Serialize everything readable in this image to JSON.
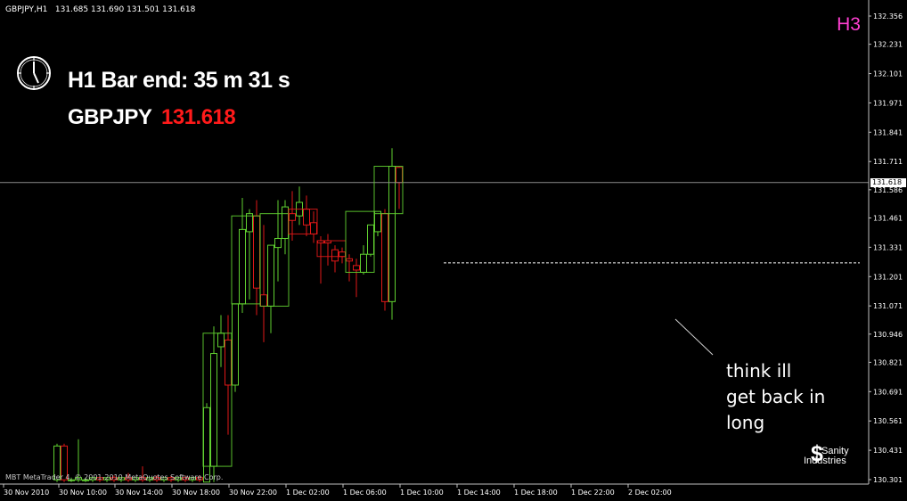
{
  "header": {
    "symbol_timeframe": "GBPJPY,H1",
    "ohlc": "131.685 131.690 131.501 131.618"
  },
  "h3_label": "H3",
  "timer": {
    "bar_end": "H1 Bar end: 35 m 31 s",
    "symbol": "GBPJPY",
    "price": "131.618",
    "icon": "clock-icon"
  },
  "annotation": {
    "lines": [
      "think ill",
      "get back in",
      "long"
    ]
  },
  "copyright": "MBT MetaTrader 4, © 2001-2010 MetaQuotes Software Corp.",
  "logo": {
    "line1": "Sanity",
    "line2": "Industries",
    "icon": "dollar-icon"
  },
  "current_price_tag": "131.618",
  "colors": {
    "background": "#000000",
    "bull": "#60d030",
    "bear": "#e01818",
    "axis": "#c0c0c0",
    "h3": "#ff3fd2",
    "timer_price": "#ff1a1a"
  },
  "chart_data": {
    "type": "candlestick",
    "symbol": "GBPJPY",
    "timeframe": "H1",
    "y_ticks": [
      "132.356",
      "132.231",
      "132.101",
      "131.971",
      "131.841",
      "131.711",
      "131.586",
      "131.461",
      "131.331",
      "131.201",
      "131.071",
      "130.946",
      "130.821",
      "130.691",
      "130.561",
      "130.431",
      "130.301"
    ],
    "x_ticks": [
      "30 Nov 2010",
      "30 Nov 10:00",
      "30 Nov 14:00",
      "30 Nov 18:00",
      "30 Nov 22:00",
      "1 Dec 02:00",
      "1 Dec 06:00",
      "1 Dec 10:00",
      "1 Dec 14:00",
      "1 Dec 18:00",
      "1 Dec 22:00",
      "2 Dec 02:00"
    ],
    "ylim": [
      130.29,
      132.4
    ],
    "current_price": 131.618,
    "h3_level": 131.262,
    "candles": [
      {
        "o": 130.3,
        "h": 130.46,
        "l": 130.29,
        "c": 130.45
      },
      {
        "o": 130.45,
        "h": 130.46,
        "l": 130.29,
        "c": 130.3
      },
      {
        "o": 130.3,
        "h": 130.31,
        "l": 130.29,
        "c": 130.3
      },
      {
        "o": 130.3,
        "h": 130.48,
        "l": 130.29,
        "c": 130.31
      },
      {
        "o": 130.3,
        "h": 130.31,
        "l": 130.29,
        "c": 130.3
      },
      {
        "o": 130.3,
        "h": 130.31,
        "l": 130.29,
        "c": 130.31
      },
      {
        "o": 130.31,
        "h": 130.32,
        "l": 130.29,
        "c": 130.3
      },
      {
        "o": 130.3,
        "h": 130.31,
        "l": 130.29,
        "c": 130.31
      },
      {
        "o": 130.31,
        "h": 130.32,
        "l": 130.29,
        "c": 130.3
      },
      {
        "o": 130.3,
        "h": 130.31,
        "l": 130.29,
        "c": 130.31
      },
      {
        "o": 130.31,
        "h": 130.33,
        "l": 130.29,
        "c": 130.3
      },
      {
        "o": 130.3,
        "h": 130.31,
        "l": 130.29,
        "c": 130.31
      },
      {
        "o": 130.31,
        "h": 130.36,
        "l": 130.29,
        "c": 130.3
      },
      {
        "o": 130.3,
        "h": 130.31,
        "l": 130.29,
        "c": 130.31
      },
      {
        "o": 130.31,
        "h": 130.32,
        "l": 130.29,
        "c": 130.3
      },
      {
        "o": 130.3,
        "h": 130.31,
        "l": 130.29,
        "c": 130.31
      },
      {
        "o": 130.31,
        "h": 130.32,
        "l": 130.29,
        "c": 130.3
      },
      {
        "o": 130.3,
        "h": 130.31,
        "l": 130.29,
        "c": 130.31
      },
      {
        "o": 130.31,
        "h": 130.32,
        "l": 130.29,
        "c": 130.3
      },
      {
        "o": 130.3,
        "h": 130.31,
        "l": 130.29,
        "c": 130.31
      },
      {
        "o": 130.31,
        "h": 130.32,
        "l": 130.29,
        "c": 130.3
      },
      {
        "o": 130.29,
        "h": 130.64,
        "l": 130.29,
        "c": 130.62
      },
      {
        "o": 130.36,
        "h": 130.98,
        "l": 130.29,
        "c": 130.86
      },
      {
        "o": 130.89,
        "h": 131.03,
        "l": 130.8,
        "c": 130.95
      },
      {
        "o": 130.92,
        "h": 131.03,
        "l": 130.5,
        "c": 130.72
      },
      {
        "o": 130.72,
        "h": 131.08,
        "l": 130.69,
        "c": 131.08
      },
      {
        "o": 131.08,
        "h": 131.55,
        "l": 131.04,
        "c": 131.41
      },
      {
        "o": 131.4,
        "h": 131.5,
        "l": 131.1,
        "c": 131.48
      },
      {
        "o": 131.47,
        "h": 131.54,
        "l": 131.03,
        "c": 131.15
      },
      {
        "o": 131.12,
        "h": 131.43,
        "l": 130.91,
        "c": 131.07
      },
      {
        "o": 131.07,
        "h": 131.3,
        "l": 130.95,
        "c": 131.34
      },
      {
        "o": 131.33,
        "h": 131.54,
        "l": 131.18,
        "c": 131.37
      },
      {
        "o": 131.37,
        "h": 131.54,
        "l": 131.3,
        "c": 131.51
      },
      {
        "o": 131.48,
        "h": 131.58,
        "l": 131.36,
        "c": 131.45
      },
      {
        "o": 131.47,
        "h": 131.6,
        "l": 131.43,
        "c": 131.53
      },
      {
        "o": 131.5,
        "h": 131.56,
        "l": 131.38,
        "c": 131.43
      },
      {
        "o": 131.44,
        "h": 131.49,
        "l": 131.35,
        "c": 131.39
      },
      {
        "o": 131.36,
        "h": 131.38,
        "l": 131.17,
        "c": 131.35
      },
      {
        "o": 131.36,
        "h": 131.39,
        "l": 131.25,
        "c": 131.35
      },
      {
        "o": 131.32,
        "h": 131.34,
        "l": 131.22,
        "c": 131.27
      },
      {
        "o": 131.31,
        "h": 131.33,
        "l": 131.26,
        "c": 131.29
      },
      {
        "o": 131.28,
        "h": 131.3,
        "l": 131.18,
        "c": 131.27
      },
      {
        "o": 131.25,
        "h": 131.28,
        "l": 131.11,
        "c": 131.23
      },
      {
        "o": 131.22,
        "h": 131.34,
        "l": 131.21,
        "c": 131.3
      },
      {
        "o": 131.3,
        "h": 131.42,
        "l": 131.29,
        "c": 131.43
      },
      {
        "o": 131.4,
        "h": 131.49,
        "l": 131.38,
        "c": 131.49
      },
      {
        "o": 131.48,
        "h": 131.5,
        "l": 131.05,
        "c": 131.09
      },
      {
        "o": 131.09,
        "h": 131.77,
        "l": 131.01,
        "c": 131.69
      },
      {
        "o": 131.685,
        "h": 131.69,
        "l": 131.501,
        "c": 131.618
      }
    ]
  }
}
